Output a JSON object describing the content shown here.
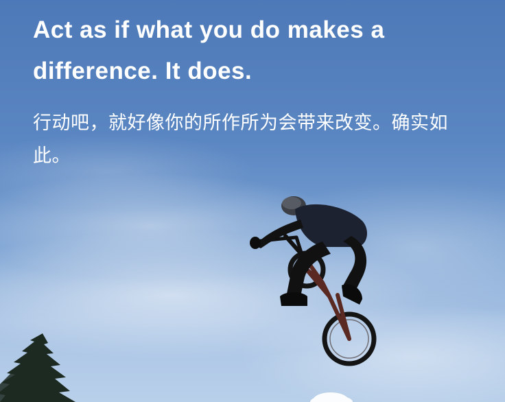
{
  "quote": {
    "english": "Act as if what you do makes a difference. It does.",
    "chinese": "行动吧，就好像你的所作所为会带来改变。确实如此。"
  },
  "photo": {
    "subject": "bmx-rider-icon",
    "sky_color": "#4e79b8"
  }
}
